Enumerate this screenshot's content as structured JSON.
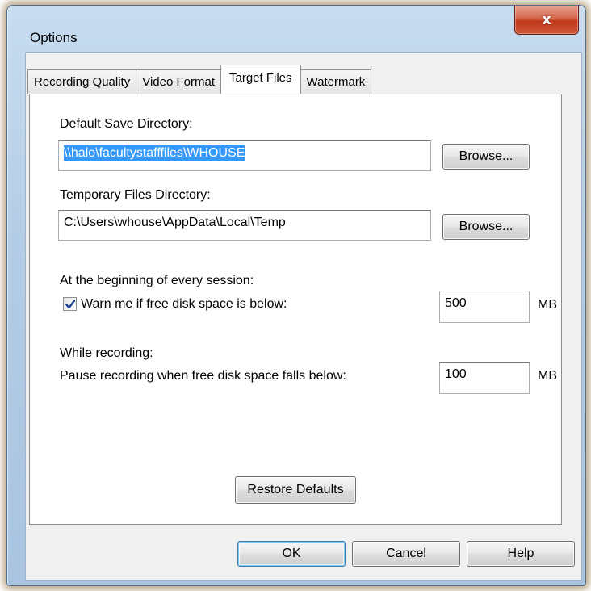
{
  "window": {
    "title": "Options",
    "close_glyph": "x"
  },
  "tabs": [
    {
      "label": "Recording Quality",
      "active": false
    },
    {
      "label": "Video Format",
      "active": false
    },
    {
      "label": "Target Files",
      "active": true
    },
    {
      "label": "Watermark",
      "active": false
    }
  ],
  "default_save": {
    "label": "Default Save Directory:",
    "value": "\\\\halo\\facultystafffiles\\WHOUSE",
    "browse_label": "Browse..."
  },
  "temp_dir": {
    "label": "Temporary Files Directory:",
    "value": "C:\\Users\\whouse\\AppData\\Local\\Temp",
    "browse_label": "Browse..."
  },
  "session": {
    "heading": "At the beginning of every session:",
    "warn_label": "Warn me if free disk space is below:",
    "warn_checked": true,
    "warn_value": "500",
    "warn_unit": "MB"
  },
  "recording": {
    "heading": "While recording:",
    "pause_label": "Pause recording when free disk space falls below:",
    "pause_value": "100",
    "pause_unit": "MB"
  },
  "restore_defaults_label": "Restore Defaults",
  "footer": {
    "ok_label": "OK",
    "cancel_label": "Cancel",
    "help_label": "Help"
  },
  "icons": {
    "close": "close-icon",
    "check": "checkmark-icon"
  },
  "colors": {
    "selection": "#3399ff",
    "close_button": "#c1391b",
    "default_button_border": "#3c7fb1"
  }
}
